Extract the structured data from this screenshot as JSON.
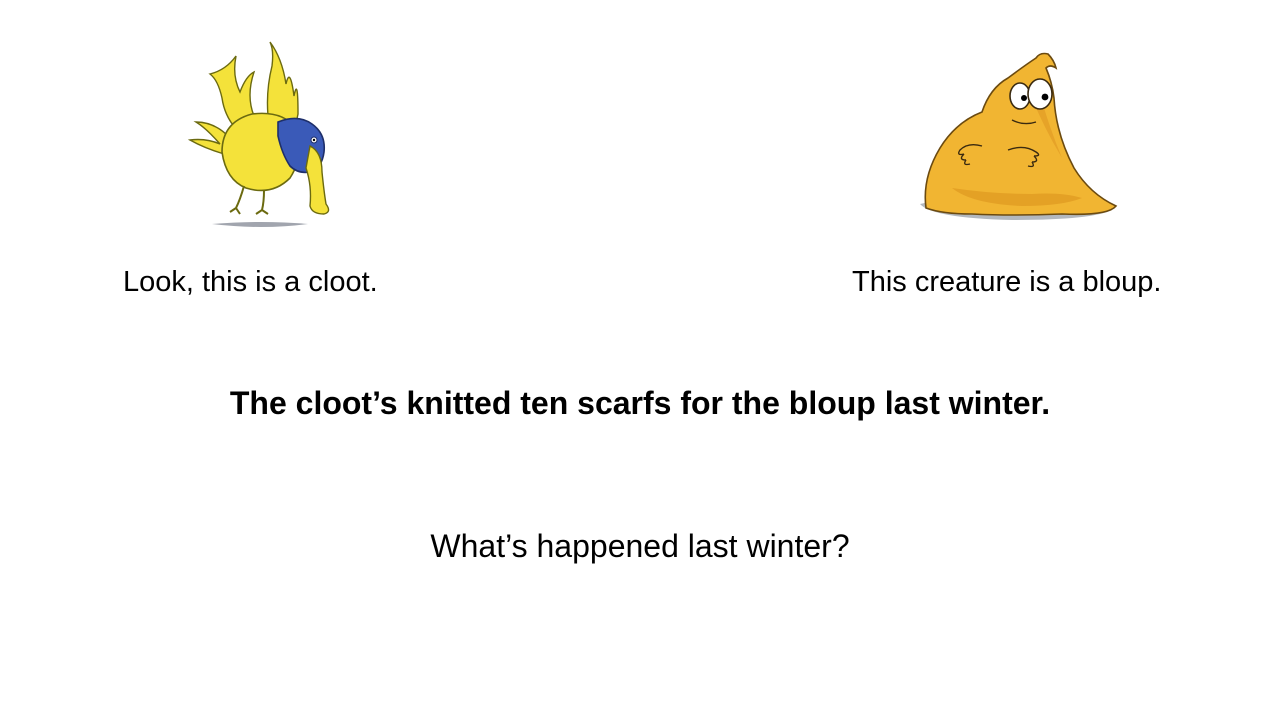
{
  "slide": {
    "left_caption": "Look, this is a cloot.",
    "right_caption": "This creature is a bloup.",
    "statement": "The cloot’s knitted ten scarfs for the bloup last winter.",
    "question": "What’s happened  last winter?"
  },
  "illustrations": {
    "left": {
      "icon": "cloot-creature-illustration",
      "colors": {
        "body": "#f4e23a",
        "head": "#3a5ab8",
        "outline": "#6b6a10",
        "shadow": "#8a8f9a"
      }
    },
    "right": {
      "icon": "bloup-creature-illustration",
      "colors": {
        "body": "#f1b532",
        "shade": "#d98f1c",
        "outline": "#6b4a10",
        "shadow": "#9aa0aa"
      }
    }
  }
}
